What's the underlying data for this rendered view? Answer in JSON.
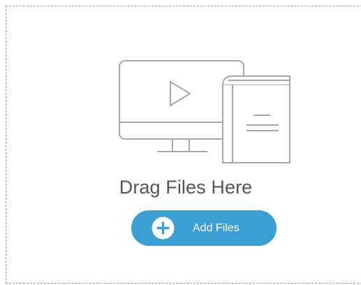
{
  "drop_zone": {
    "heading": "Drag Files Here",
    "illustration_icon": "media-monitor-and-book-icon",
    "border_color": "#9a9a9a"
  },
  "add_files_button": {
    "label": "Add Files",
    "icon": "plus-circle-icon",
    "background_color": "#3a9fd2",
    "text_color": "#ffffff"
  }
}
